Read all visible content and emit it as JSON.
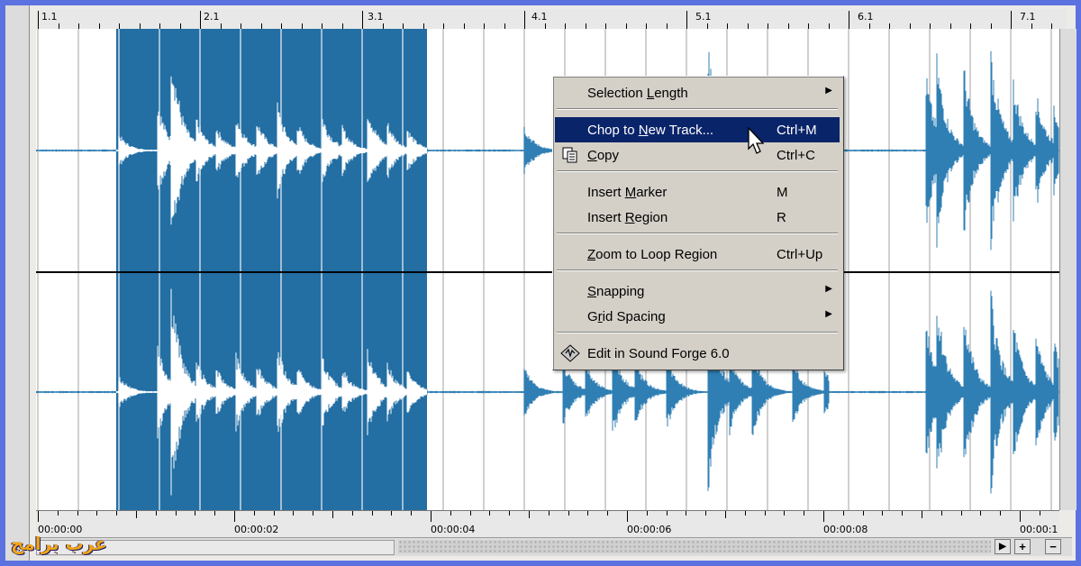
{
  "ruler_top": {
    "labels": [
      "1.1",
      "2.1",
      "3.1",
      "4.1",
      "5.1",
      "6.1",
      "7.1"
    ]
  },
  "ruler_bottom": {
    "labels": [
      "00:00:00",
      "00:00:02",
      "00:00:04",
      "00:00:06",
      "00:00:08",
      "00:00:1"
    ]
  },
  "context_menu": {
    "items": [
      {
        "pre": "Selection ",
        "ul": "L",
        "post": "ength",
        "shortcut": "",
        "submenu": true
      },
      {
        "pre": "Chop to ",
        "ul": "N",
        "post": "ew Track...",
        "shortcut": "Ctrl+M",
        "submenu": false,
        "highlighted": true
      },
      {
        "pre": "",
        "ul": "C",
        "post": "opy",
        "shortcut": "Ctrl+C",
        "submenu": false,
        "icon": "copy-icon"
      },
      {
        "pre": "Insert ",
        "ul": "M",
        "post": "arker",
        "shortcut": "M",
        "submenu": false
      },
      {
        "pre": "Insert ",
        "ul": "R",
        "post": "egion",
        "shortcut": "R",
        "submenu": false
      },
      {
        "pre": "",
        "ul": "Z",
        "post": "oom to Loop Region",
        "shortcut": "Ctrl+Up",
        "submenu": false
      },
      {
        "pre": "",
        "ul": "S",
        "post": "napping",
        "shortcut": "",
        "submenu": true
      },
      {
        "pre": "G",
        "ul": "r",
        "post": "id Spacing",
        "shortcut": "",
        "submenu": true
      },
      {
        "pre": "Edit in Sound Forge 6.0",
        "ul": "",
        "post": "",
        "shortcut": "",
        "submenu": false,
        "icon": "sound-forge-icon"
      }
    ]
  },
  "scrollbar": {
    "right_label": "▶",
    "zoom_in": "+",
    "zoom_out": "−"
  },
  "logo_text": "عرب برامج",
  "colors": {
    "waveform": "#2f7fb4",
    "selection": "#236ea3",
    "highlight": "#0a246a",
    "background": "#5c72e0"
  }
}
